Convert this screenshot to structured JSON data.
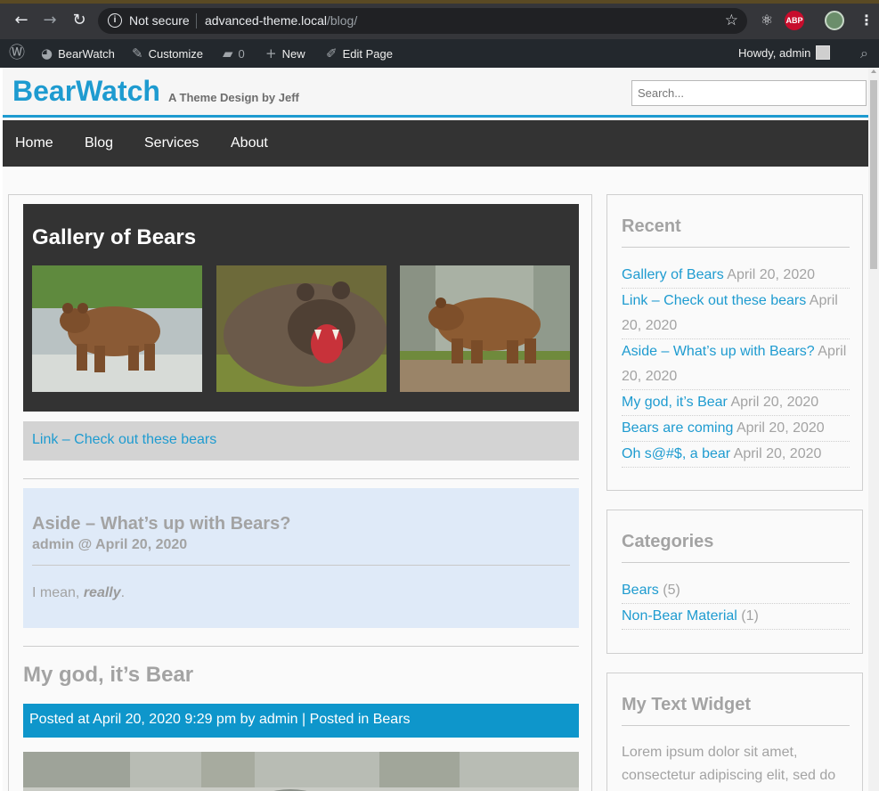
{
  "browser": {
    "security_label": "Not secure",
    "url_host": "advanced-theme.local",
    "url_path": "/blog/",
    "abp_label": "ABP"
  },
  "adminbar": {
    "site_name": "BearWatch",
    "customize": "Customize",
    "comments_count": "0",
    "new": "New",
    "edit_page": "Edit Page",
    "howdy": "Howdy, admin"
  },
  "site": {
    "title": "BearWatch",
    "description": "A Theme Design by Jeff",
    "search_placeholder": "Search..."
  },
  "nav": [
    "Home",
    "Blog",
    "Services",
    "About"
  ],
  "posts": {
    "gallery_title": "Gallery of Bears",
    "link_text": "Link – Check out these bears",
    "aside_title": "Aside – What’s up with Bears?",
    "aside_meta": "admin @ April 20, 2020",
    "aside_body_prefix": "I mean, ",
    "aside_body_emph": "really",
    "aside_body_suffix": ".",
    "post_title": "My god, it’s Bear",
    "post_meta_prefix": "Posted at April 20, 2020 9:29 pm by admin | Posted in ",
    "post_meta_category": "Bears"
  },
  "sidebar": {
    "recent": {
      "title": "Recent",
      "items": [
        {
          "title": "Gallery of Bears",
          "date": "April 20, 2020"
        },
        {
          "title": "Link – Check out these bears",
          "date": "April 20, 2020"
        },
        {
          "title": "Aside – What’s up with Bears?",
          "date": "April 20, 2020"
        },
        {
          "title": "My god, it’s Bear",
          "date": "April 20, 2020"
        },
        {
          "title": "Bears are coming",
          "date": "April 20, 2020"
        },
        {
          "title": "Oh s@#$, a bear",
          "date": "April 20, 2020"
        }
      ]
    },
    "categories": {
      "title": "Categories",
      "items": [
        {
          "name": "Bears",
          "count": "(5)"
        },
        {
          "name": "Non-Bear Material",
          "count": "(1)"
        }
      ]
    },
    "text_widget": {
      "title": "My Text Widget",
      "body": "Lorem ipsum dolor sit amet, consectetur adipiscing elit, sed do eiusmod tempor incididunt ut labore"
    }
  },
  "colors": {
    "accent": "#1e9bd0",
    "nav_bg": "#333333",
    "meta_bar": "#0e96cb"
  }
}
